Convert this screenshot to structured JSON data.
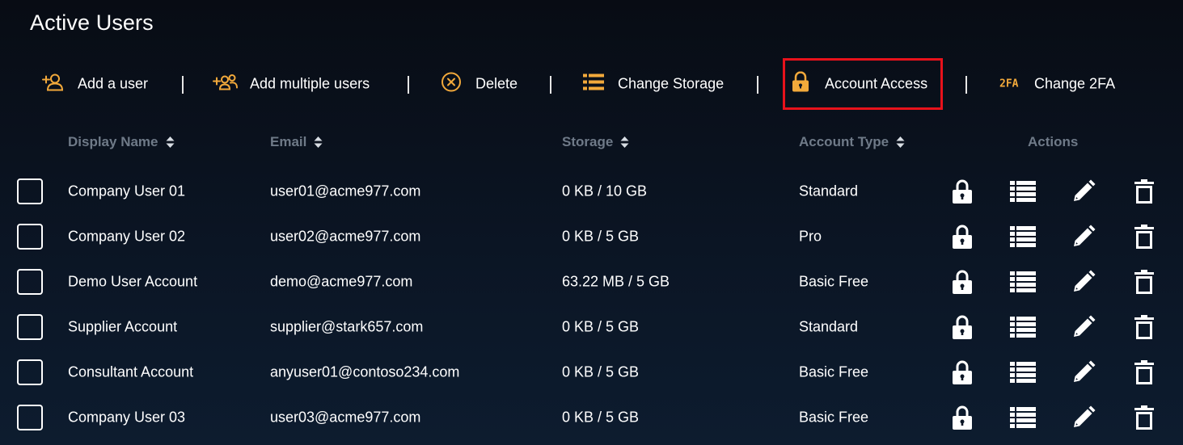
{
  "page": {
    "title": "Active Users"
  },
  "toolbar": {
    "add_user": "Add a user",
    "add_multiple": "Add multiple users",
    "delete": "Delete",
    "change_storage": "Change Storage",
    "account_access": "Account Access",
    "change_2fa": "Change 2FA",
    "twofa_icon_text": "2FA"
  },
  "colors": {
    "accent": "#f2a93b",
    "highlight": "#e8121b",
    "header_text": "#6f7a88"
  },
  "table": {
    "headers": {
      "display_name": "Display Name",
      "email": "Email",
      "storage": "Storage",
      "account_type": "Account Type",
      "actions": "Actions"
    },
    "rows": [
      {
        "name": "Company User 01",
        "email": "user01@acme977.com",
        "storage": "0 KB / 10 GB",
        "type": "Standard"
      },
      {
        "name": "Company User 02",
        "email": "user02@acme977.com",
        "storage": "0 KB / 5 GB",
        "type": "Pro"
      },
      {
        "name": "Demo User Account",
        "email": "demo@acme977.com",
        "storage": "63.22 MB / 5 GB",
        "type": "Basic Free"
      },
      {
        "name": "Supplier Account",
        "email": "supplier@stark657.com",
        "storage": "0 KB / 5 GB",
        "type": "Standard"
      },
      {
        "name": "Consultant Account",
        "email": "anyuser01@contoso234.com",
        "storage": "0 KB / 5 GB",
        "type": "Basic Free"
      },
      {
        "name": "Company User 03",
        "email": "user03@acme977.com",
        "storage": "0 KB / 5 GB",
        "type": "Basic Free"
      }
    ],
    "row_action_icons": [
      "lock-icon",
      "storage-list-icon",
      "pencil-icon",
      "trash-icon"
    ]
  }
}
